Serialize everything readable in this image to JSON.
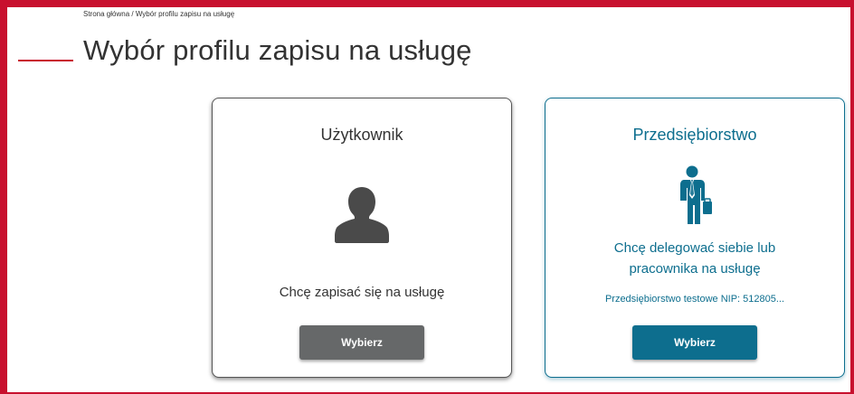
{
  "breadcrumb": {
    "home": "Strona główna",
    "separator": " / ",
    "current": "Wybór profilu zapisu na usługę"
  },
  "page": {
    "title": "Wybór profilu zapisu na usługę"
  },
  "cards": {
    "user": {
      "title": "Użytkownik",
      "icon": "user-silhouette-icon",
      "description": "Chcę zapisać się na usługę",
      "button_label": "Wybierz"
    },
    "company": {
      "title": "Przedsiębiorstwo",
      "icon": "businessman-with-briefcase-icon",
      "description_line1": "Chcę delegować siebie lub",
      "description_line2": "pracownika na usługę",
      "nip_text": "Przedsiębiorstwo testowe NIP: 512805...",
      "button_label": "Wybierz"
    }
  },
  "colors": {
    "accent_red": "#c8102e",
    "brand_teal": "#0d6e8e",
    "user_button_gray": "#666869",
    "text_dark": "#333333"
  }
}
